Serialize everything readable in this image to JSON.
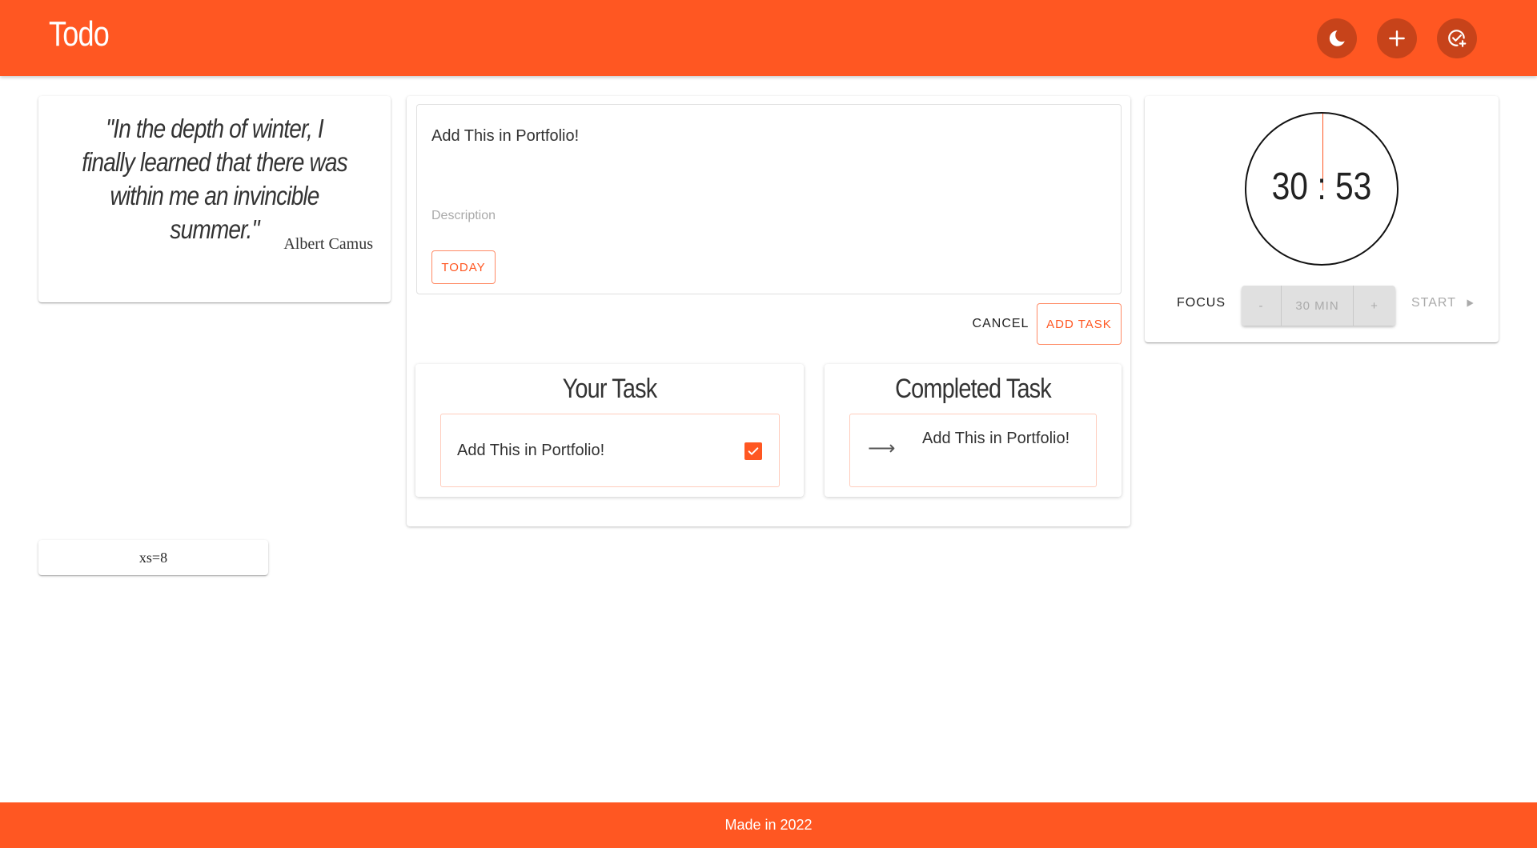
{
  "header": {
    "title": "Todo",
    "actions": [
      {
        "icon": "moon-icon"
      },
      {
        "icon": "plus-icon"
      },
      {
        "icon": "check-circle-plus-icon"
      }
    ]
  },
  "quote": {
    "text": "\"In the depth of winter, I finally learned that there was within me an invincible summer.\"",
    "author": "Albert Camus"
  },
  "grid_card": {
    "label": "xs=8"
  },
  "editor": {
    "title_value": "Add This in Portfolio!",
    "description_placeholder": "Description",
    "today_label": "TODAY",
    "cancel_label": "CANCEL",
    "add_task_label": "ADD TASK"
  },
  "lists": {
    "your_task": {
      "title": "Your Task",
      "items": [
        {
          "text": "Add This in Portfolio!",
          "checked": true
        }
      ]
    },
    "completed_task": {
      "title": "Completed Task",
      "items": [
        {
          "text": "Add This in Portfolio!"
        }
      ]
    }
  },
  "timer": {
    "time": "30 : 53",
    "focus_label": "FOCUS",
    "minus_label": "-",
    "duration_label": "30 MIN",
    "plus_label": "+",
    "start_label": "START"
  },
  "footer": {
    "text": "Made in 2022"
  },
  "colors": {
    "accent": "#ff5722",
    "accent_light": "#ff8a65"
  }
}
